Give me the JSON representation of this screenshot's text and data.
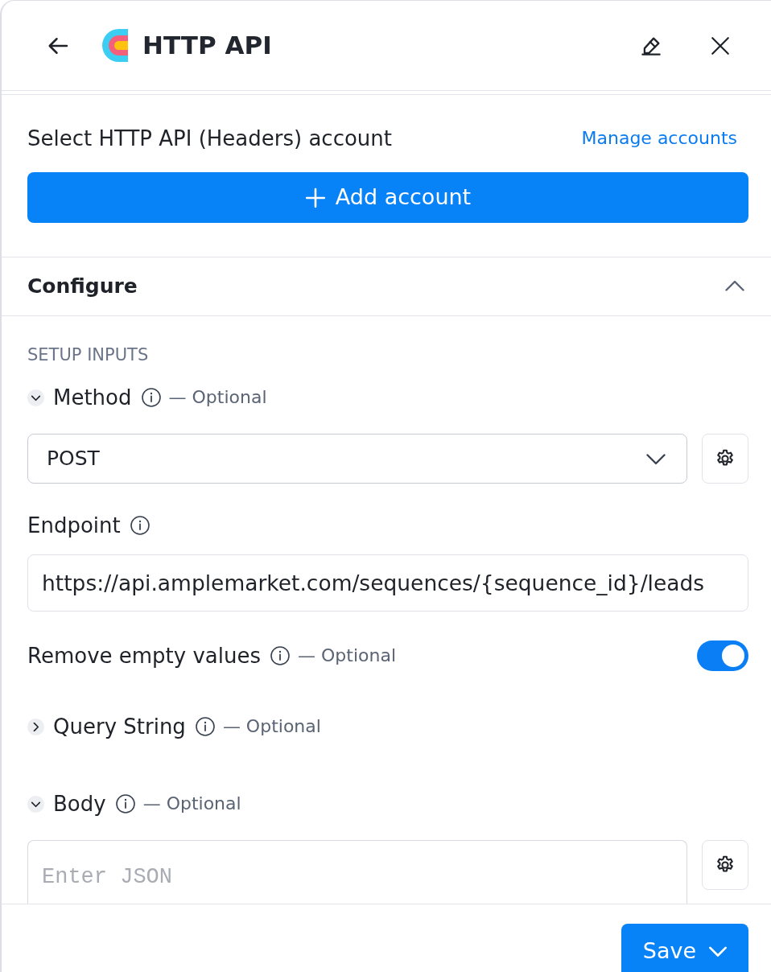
{
  "header": {
    "title": "HTTP API"
  },
  "account": {
    "label": "Select HTTP API (Headers) account",
    "link": "Manage accounts",
    "button": "Add account"
  },
  "configure": {
    "title": "Configure",
    "expanded": true,
    "section_label": "SETUP INPUTS",
    "fields": [
      {
        "kind": "select",
        "label": "Method",
        "expanded": true,
        "optional": "— Optional",
        "value": "POST"
      },
      {
        "kind": "text",
        "label": "Endpoint",
        "value": "https://api.amplemarket.com/sequences/{sequence_id}/leads"
      },
      {
        "kind": "toggle",
        "label": "Remove empty values",
        "optional": "— Optional",
        "on": true
      },
      {
        "kind": "group",
        "label": "Query String",
        "expanded": false,
        "optional": "— Optional"
      },
      {
        "kind": "json",
        "label": "Body",
        "expanded": true,
        "optional": "— Optional",
        "placeholder": "Enter JSON"
      }
    ]
  },
  "footer": {
    "button": "Save"
  }
}
